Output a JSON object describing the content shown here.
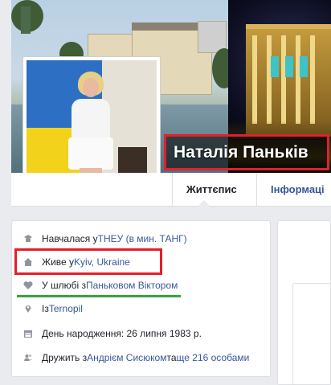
{
  "profile": {
    "name": "Наталія Паньків"
  },
  "tabs": [
    {
      "label": "Життєпис",
      "active": true
    },
    {
      "label": "Інформаці",
      "active": false
    }
  ],
  "intro": {
    "studied": {
      "prefix": "Навчалася у ",
      "link": "ТНЕУ (в мин. ТАНГ)",
      "icon": "education-icon"
    },
    "lives": {
      "prefix": "Живе у ",
      "link": "Kyiv, Ukraine",
      "icon": "home-icon"
    },
    "married": {
      "prefix": "У шлюбі з ",
      "link": "Паньковом Віктором",
      "icon": "heart-icon"
    },
    "from": {
      "prefix": "Із ",
      "link": "Ternopil",
      "icon": "location-pin-icon"
    },
    "birthday": {
      "text": "День народження: 26 липня 1983 р.",
      "icon": "calendar-icon"
    },
    "friends": {
      "prefix": "Дружить з ",
      "link1": "Андрієм Сисюком",
      "middle": " та ",
      "link2": "ще 216 особами",
      "icon": "friends-icon"
    }
  },
  "colors": {
    "link": "#365899",
    "highlight_red": "#e41f2b",
    "highlight_green": "#33a63a",
    "page_bg": "#e9ebee"
  }
}
